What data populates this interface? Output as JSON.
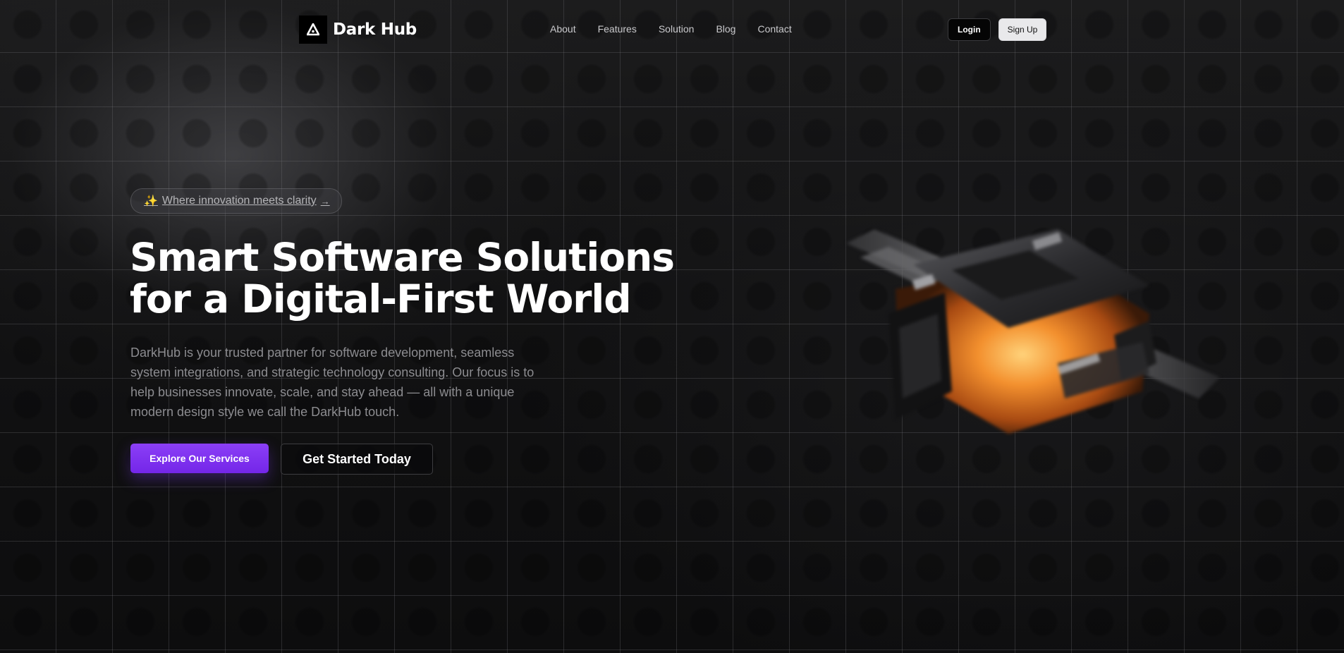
{
  "nav": {
    "brand": "Dark Hub",
    "links": [
      "About",
      "Features",
      "Solution",
      "Blog",
      "Contact"
    ],
    "login_label": "Login",
    "signup_label": "Sign Up"
  },
  "hero": {
    "badge_text": "Where innovation meets clarity",
    "badge_arrow": "→",
    "badge_icon": "sparkles-icon",
    "title_line1": "Smart Software Solutions",
    "title_line2": "for a Digital-First World",
    "description": "DarkHub is your trusted partner for software development, seamless system integrations, and strategic technology consulting. Our focus is to help businesses innovate, scale, and stay ahead — all with a unique modern design style we call the DarkHub touch.",
    "primary_cta": "Explore Our Services",
    "secondary_cta": "Get Started Today"
  },
  "colors": {
    "background": "#0c0c0d",
    "accent": "#7c3aed",
    "art_glow": "#f0872a"
  }
}
